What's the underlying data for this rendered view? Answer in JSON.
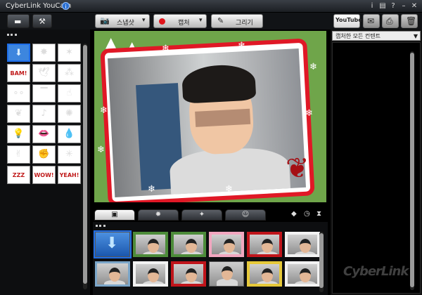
{
  "window": {
    "title": "CyberLink YouCam",
    "controls": {
      "info": "i",
      "help": "?",
      "minimize": "–",
      "close": "✕"
    }
  },
  "toolbar": {
    "snapshot_label": "스냅샷",
    "capture_label": "캡처",
    "draw_label": "그리기",
    "youtube_label": "YouTube"
  },
  "right_panel": {
    "filter_selected": "캡처한 모든 컨텐트"
  },
  "effects_grid": [
    {
      "icon": "download-arrow-icon",
      "glyph": "⬇",
      "selected": true
    },
    {
      "icon": "burst-sticker-icon",
      "glyph": "✸"
    },
    {
      "icon": "sparkle-sticker-icon",
      "glyph": "✶"
    },
    {
      "icon": "bam-sticker-icon",
      "glyph": "BAM!"
    },
    {
      "icon": "bird-sticker-icon",
      "glyph": "🕊"
    },
    {
      "icon": "confetti-sticker-icon",
      "glyph": "⁂"
    },
    {
      "icon": "bubbles-sticker-icon",
      "glyph": "∘∘"
    },
    {
      "icon": "ink-splash-icon",
      "glyph": "▔"
    },
    {
      "icon": "hand-sticker-icon",
      "glyph": "☝"
    },
    {
      "icon": "leaves-sticker-icon",
      "glyph": "❦"
    },
    {
      "icon": "music-note-sticker-icon",
      "glyph": "♪"
    },
    {
      "icon": "rays-sticker-icon",
      "glyph": "✺"
    },
    {
      "icon": "lightbulb-sticker-icon",
      "glyph": "💡"
    },
    {
      "icon": "lips-sticker-icon",
      "glyph": "👄"
    },
    {
      "icon": "drop-sticker-icon",
      "glyph": "💧"
    },
    {
      "icon": "peace-hand-sticker-icon",
      "glyph": "✌"
    },
    {
      "icon": "punch-sticker-icon",
      "glyph": "✊"
    },
    {
      "icon": "starburst-sticker-icon",
      "glyph": "✳"
    },
    {
      "icon": "zzz-sticker-icon",
      "glyph": "ZZZ"
    },
    {
      "icon": "wow-sticker-icon",
      "glyph": "WOW!"
    },
    {
      "icon": "yeah-sticker-icon",
      "glyph": "YEAH!"
    }
  ],
  "bottom_tabs": [
    {
      "icon": "camera-tab-icon",
      "glyph": "▣",
      "active": true
    },
    {
      "icon": "effects-tab-icon",
      "glyph": "✹"
    },
    {
      "icon": "magic-wand-tab-icon",
      "glyph": "✦"
    },
    {
      "icon": "emotion-tab-icon",
      "glyph": "☺"
    }
  ],
  "colors": {
    "accent_blue": "#1e6de8",
    "frame_red": "#e01826",
    "background_green": "#6fa54a"
  },
  "watermark": "CyberLink"
}
